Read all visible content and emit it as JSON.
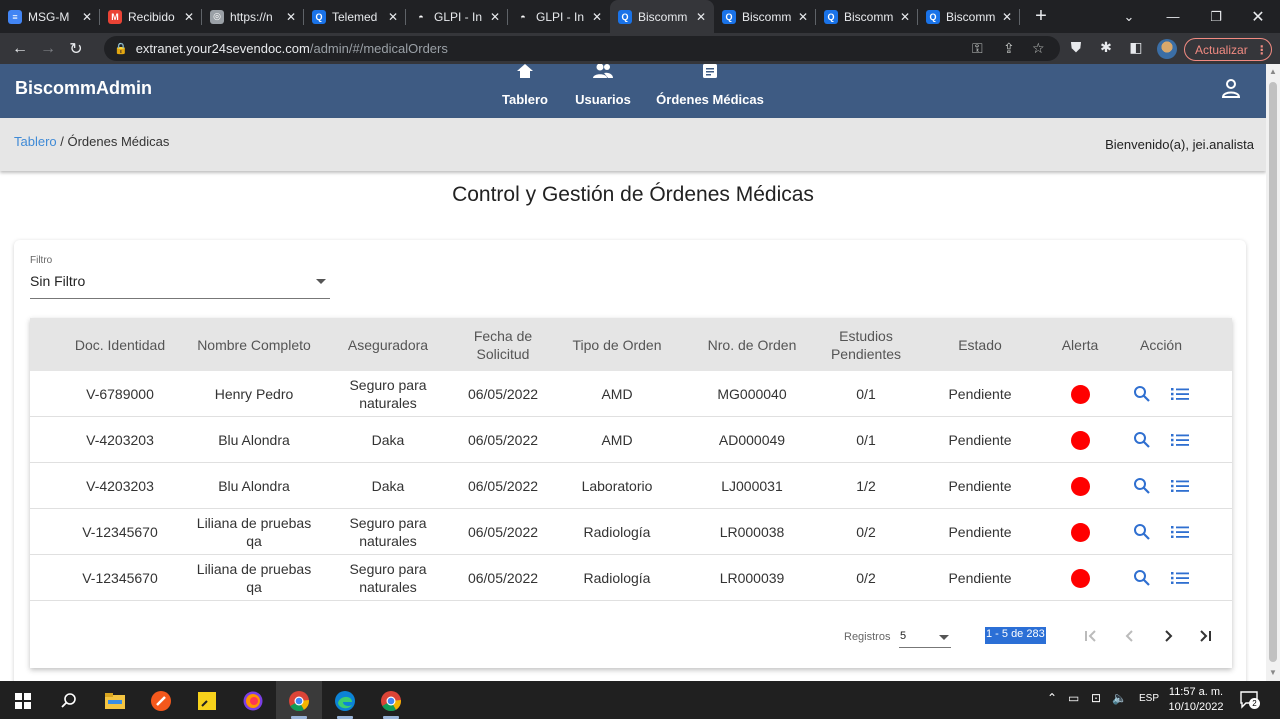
{
  "browser": {
    "tabs": [
      {
        "title": "MSG-M",
        "color": "#4285f4",
        "glyph": "≡"
      },
      {
        "title": "Recibido",
        "color": "#ea4335",
        "glyph": "M"
      },
      {
        "title": "https://n",
        "color": "#9aa0a6",
        "glyph": "◎"
      },
      {
        "title": "Telemed",
        "color": "#1a73e8",
        "glyph": "Q"
      },
      {
        "title": "GLPI - In",
        "color": "#ffffff",
        "glyph": "◓"
      },
      {
        "title": "GLPI - In",
        "color": "#ffffff",
        "glyph": "◓"
      },
      {
        "title": "Biscomm",
        "color": "#1a73e8",
        "glyph": "Q"
      },
      {
        "title": "Biscomm",
        "color": "#1a73e8",
        "glyph": "Q"
      },
      {
        "title": "Biscomm",
        "color": "#1a73e8",
        "glyph": "Q"
      },
      {
        "title": "Biscomm",
        "color": "#1a73e8",
        "glyph": "Q"
      }
    ],
    "active_tab_index": 6,
    "url_host": "extranet.your24sevendoc.com",
    "url_path": "/admin/#/medicalOrders",
    "update_label": "Actualizar"
  },
  "app": {
    "brand": "BiscommAdmin",
    "nav": [
      {
        "label": "Tablero",
        "icon": "home-icon"
      },
      {
        "label": "Usuarios",
        "icon": "people-icon"
      },
      {
        "label": "Órdenes Médicas",
        "icon": "document-icon"
      }
    ],
    "breadcrumb": {
      "link": "Tablero",
      "separator": " / ",
      "current": "Órdenes Médicas"
    },
    "welcome": "Bienvenido(a), jei.analista",
    "page_title": "Control y Gestión de Órdenes Médicas"
  },
  "filter": {
    "label": "Filtro",
    "value": "Sin Filtro"
  },
  "table": {
    "columns": [
      "Doc. Identidad",
      "Nombre Completo",
      "Aseguradora",
      "Fecha de Solicitud",
      "Tipo de Orden",
      "Nro. de Orden",
      "Estudios Pendientes",
      "Estado",
      "Alerta",
      "Acción"
    ],
    "alert_color": "#ff0000",
    "rows": [
      {
        "doc": "V-6789000",
        "name": "Henry Pedro",
        "insurer": "Seguro para naturales",
        "date": "06/05/2022",
        "type": "AMD",
        "order": "MG000040",
        "pending": "0/1",
        "status": "Pendiente"
      },
      {
        "doc": "V-4203203",
        "name": "Blu Alondra",
        "insurer": "Daka",
        "date": "06/05/2022",
        "type": "AMD",
        "order": "AD000049",
        "pending": "0/1",
        "status": "Pendiente"
      },
      {
        "doc": "V-4203203",
        "name": "Blu Alondra",
        "insurer": "Daka",
        "date": "06/05/2022",
        "type": "Laboratorio",
        "order": "LJ000031",
        "pending": "1/2",
        "status": "Pendiente"
      },
      {
        "doc": "V-12345670",
        "name": "Liliana de pruebas qa",
        "insurer": "Seguro para naturales",
        "date": "06/05/2022",
        "type": "Radiología",
        "order": "LR000038",
        "pending": "0/2",
        "status": "Pendiente"
      },
      {
        "doc": "V-12345670",
        "name": "Liliana de pruebas qa",
        "insurer": "Seguro para naturales",
        "date": "06/05/2022",
        "type": "Radiología",
        "order": "LR000039",
        "pending": "0/2",
        "status": "Pendiente"
      }
    ]
  },
  "paginator": {
    "label": "Registros",
    "page_size": "5",
    "range": "1 - 5 de 283"
  },
  "taskbar": {
    "lang": "ESP",
    "time": "11:57 a. m.",
    "date": "10/10/2022",
    "notifications": "2"
  },
  "colors": {
    "appbar": "#3e5b83",
    "link": "#3f8ad6",
    "selection": "#2b6fd6"
  }
}
